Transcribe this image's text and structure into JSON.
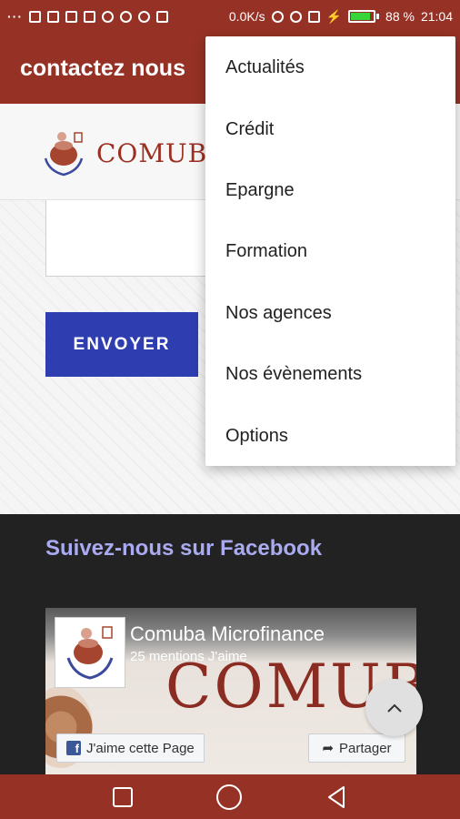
{
  "status_bar": {
    "left_icons": [
      "more-dots-icon",
      "shield-icon",
      "mail-icon",
      "gmail-icon",
      "screenshot-icon",
      "usb-icon",
      "app-icon",
      "android-icon",
      "play-store-icon"
    ],
    "net_speed": "0.0K/s",
    "right_icons": [
      "bluetooth-icon",
      "wifi-icon",
      "sim-icon",
      "charging-icon"
    ],
    "battery_percent": 88,
    "battery_label": "88 %",
    "time": "21:04"
  },
  "app_bar": {
    "title": "contactez nous"
  },
  "site": {
    "logo_text": "COMUBA",
    "send_button": "ENVOYER",
    "facebook_heading": "Suivez-nous sur Facebook",
    "fb_widget": {
      "page_name": "Comuba Microfinance",
      "likes": "25 mentions J'aime",
      "cover_text": "COMUBA",
      "like_button": "J'aime cette Page",
      "share_button": "Partager"
    }
  },
  "menu": {
    "items": [
      "Actualités",
      "Crédit",
      "Epargne",
      "Formation",
      "Nos agences",
      "Nos évènements",
      "Options"
    ]
  },
  "nav_bar": {
    "buttons": [
      "recents-button",
      "home-button",
      "back-button"
    ]
  },
  "colors": {
    "primary": "#963225",
    "button_blue": "#2e3eb0",
    "heading_lilac": "#a9aaf0",
    "battery_green": "#37d43a"
  }
}
